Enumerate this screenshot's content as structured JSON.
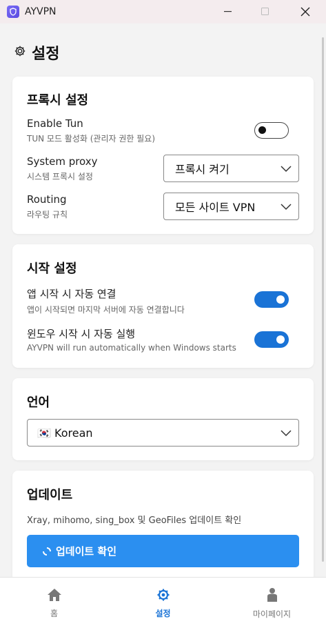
{
  "window": {
    "title": "AYVPN"
  },
  "page": {
    "title": "설정"
  },
  "proxy_card": {
    "heading": "프록시 설정",
    "enable_tun": {
      "label": "Enable Tun",
      "sub": "TUN 모드 활성화 (관리자 권한 필요)",
      "enabled": false
    },
    "system_proxy": {
      "label": "System proxy",
      "sub": "시스템 프록시 설정",
      "value": "프록시 켜기"
    },
    "routing": {
      "label": "Routing",
      "sub": "라우팅 규칙",
      "value": "모든 사이트 VPN"
    }
  },
  "startup_card": {
    "heading": "시작 설정",
    "auto_connect": {
      "label": "앱 시작 시 자동 연결",
      "sub": "앱이 시작되면 마지막 서버에 자동 연결합니다",
      "enabled": true
    },
    "auto_run": {
      "label": "윈도우 시작 시 자동 실행",
      "sub": "AYVPN will run automatically when Windows starts",
      "enabled": true
    }
  },
  "language_card": {
    "heading": "언어",
    "value": "🇰🇷 Korean"
  },
  "update_card": {
    "heading": "업데이트",
    "description": "Xray, mihomo, sing_box 및 GeoFiles 업데이트 확인",
    "button": "업데이트 확인"
  },
  "nav": {
    "home": "홈",
    "settings": "설정",
    "mypage": "마이페이지"
  },
  "colors": {
    "accent": "#1a73d6",
    "button": "#2b8ff0"
  }
}
